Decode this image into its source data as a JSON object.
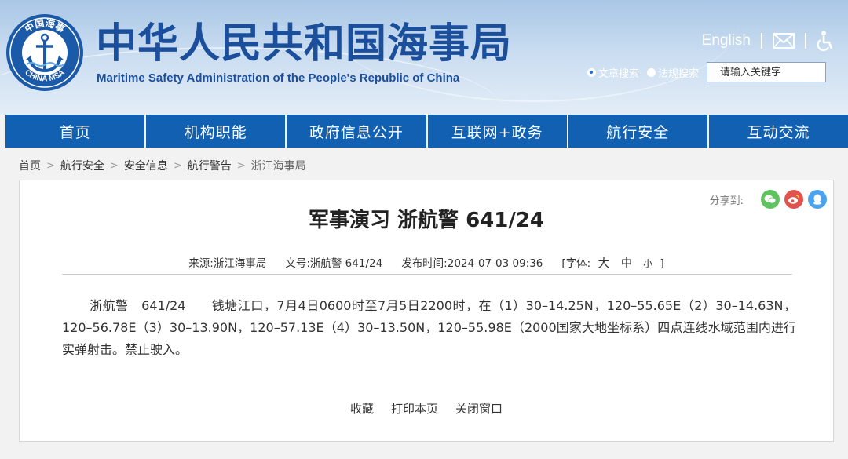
{
  "header": {
    "title": "中华人民共和国海事局",
    "subtitle": "Maritime Safety Administration of the People's Republic of China",
    "logo_top_text": "中国海事",
    "logo_bottom_text": "CHINA MSA",
    "english_link": "English",
    "mail_icon": "mail-icon",
    "accessibility_icon": "accessibility-icon"
  },
  "search": {
    "options": [
      "文章搜索",
      "法规搜索"
    ],
    "selected": "文章搜索",
    "placeholder": "请输入关键字"
  },
  "nav": {
    "items": [
      "首页",
      "机构职能",
      "政府信息公开",
      "互联网+政务",
      "航行安全",
      "互动交流"
    ]
  },
  "breadcrumb": [
    "首页",
    "航行安全",
    "安全信息",
    "航行警告",
    "浙江海事局"
  ],
  "share": {
    "label": "分享到:",
    "icons": [
      "wechat-icon",
      "weibo-icon",
      "qq-icon"
    ]
  },
  "article": {
    "title": "军事演习 浙航警 641/24",
    "source": "来源:浙江海事局",
    "doc_no": "文号:浙航警 641/24",
    "published": "发布时间:2024-07-03 09:36",
    "font_label": "[字体:",
    "font_sizes": [
      "大",
      "中",
      "小"
    ],
    "font_close": "]",
    "body": "浙航警　641/24　　钱塘江口，7月4日0600时至7月5日2200时，在（1）30–14.25N，120–55.65E（2）30–14.63N，120–56.78E（3）30–13.90N，120–57.13E（4）30–13.50N，120–55.98E（2000国家大地坐标系）四点连线水域范围内进行实弹射击。禁止驶入。"
  },
  "actions": [
    "收藏",
    "打印本页",
    "关闭窗口"
  ],
  "colors": {
    "nav_bg": "#1160b2",
    "title_blue": "#1b4f9c",
    "wechat": "#5fc35f",
    "weibo": "#e2534d",
    "qq": "#4ba3f0"
  }
}
